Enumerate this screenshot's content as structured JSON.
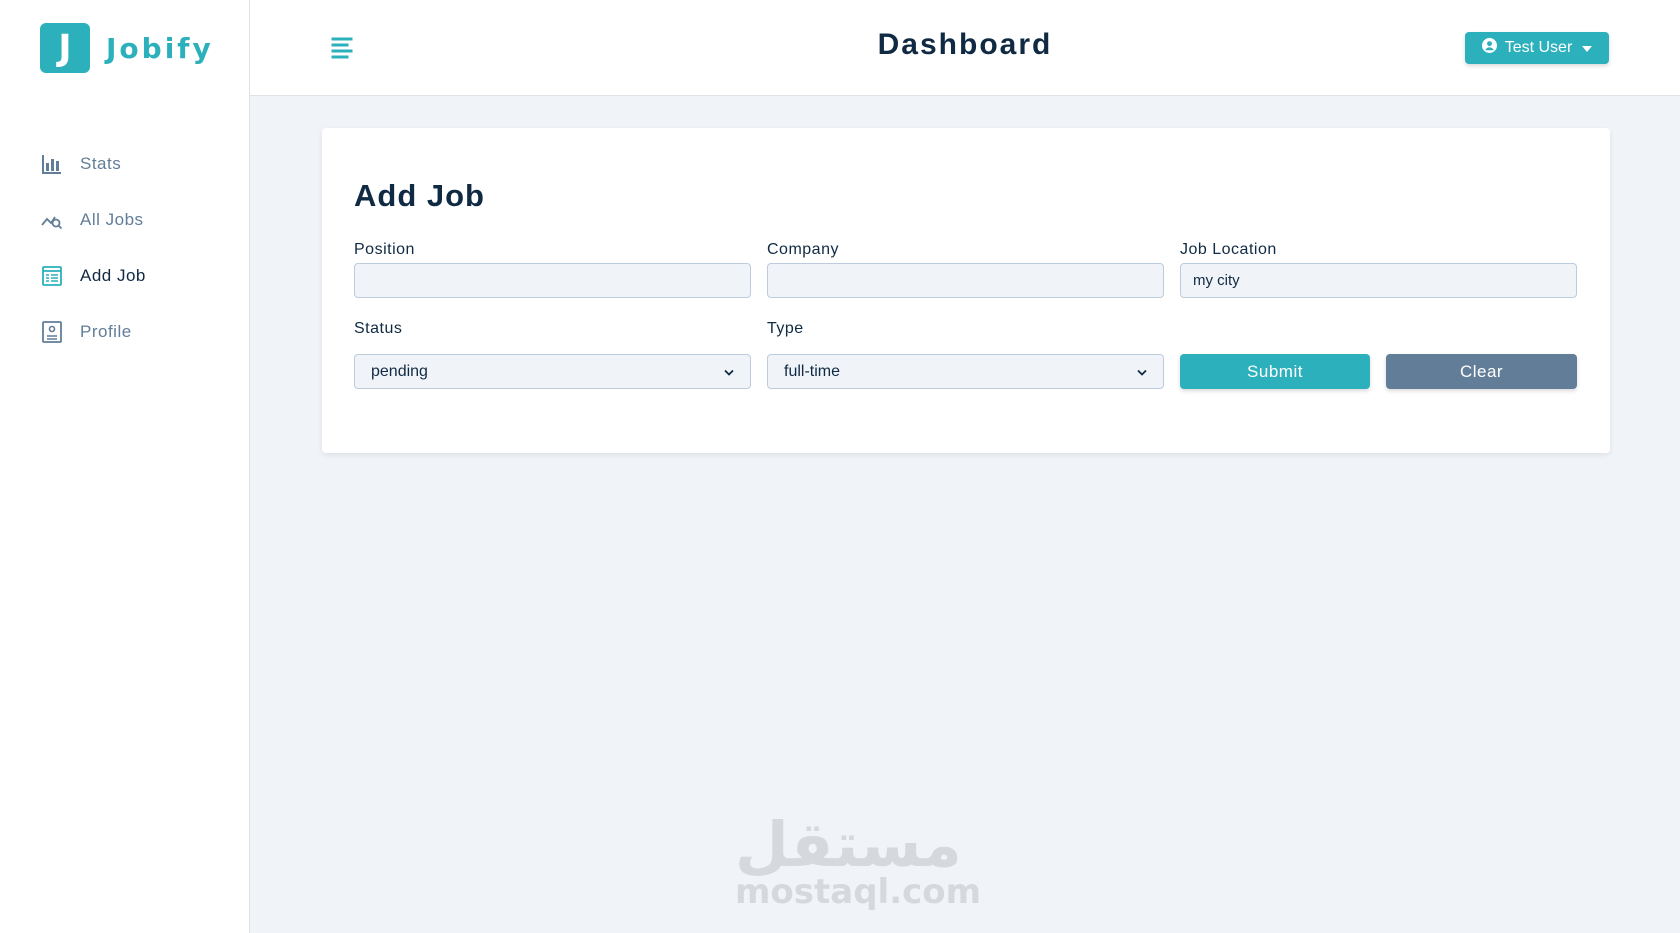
{
  "brand": {
    "logo_letter": "J",
    "name": "Jobify",
    "accent": "#2cb1bc"
  },
  "header": {
    "title": "Dashboard",
    "user_label": "Test User"
  },
  "sidebar": {
    "items": [
      {
        "label": "Stats",
        "icon": "bar-chart-icon",
        "active": false
      },
      {
        "label": "All Jobs",
        "icon": "query-stats-icon",
        "active": false
      },
      {
        "label": "Add Job",
        "icon": "form-icon",
        "active": true
      },
      {
        "label": "Profile",
        "icon": "id-card-icon",
        "active": false
      }
    ]
  },
  "form": {
    "title": "Add Job",
    "position": {
      "label": "Position",
      "value": ""
    },
    "company": {
      "label": "Company",
      "value": ""
    },
    "location": {
      "label": "Job Location",
      "value": "my city"
    },
    "status": {
      "label": "Status",
      "value": "pending"
    },
    "type": {
      "label": "Type",
      "value": "full-time"
    },
    "submit_label": "Submit",
    "clear_label": "Clear"
  },
  "watermark": {
    "arabic": "مستقل",
    "latin": "mostaql.com"
  },
  "colors": {
    "primary": "#2cb1bc",
    "secondary": "#627d98",
    "background": "#f0f4f8",
    "text": "#102a43"
  }
}
